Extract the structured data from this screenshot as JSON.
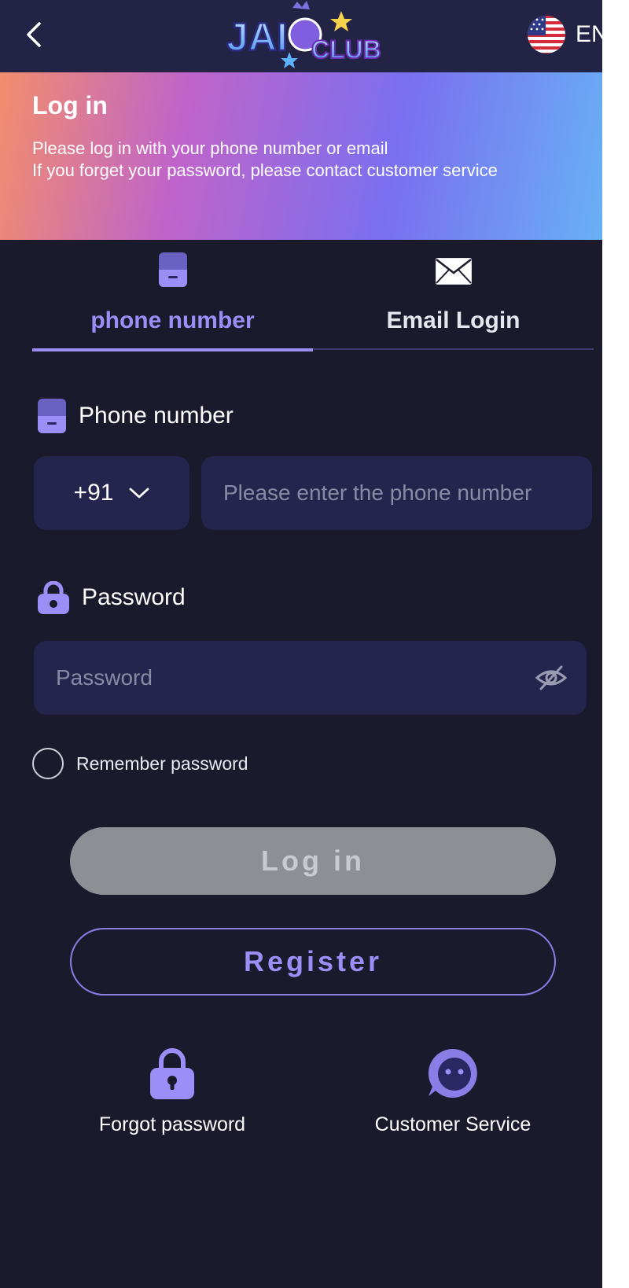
{
  "header": {
    "logo_text_main": "JAI",
    "logo_text_sub": "CLUB",
    "language_code": "EN"
  },
  "banner": {
    "title": "Log in",
    "line1": "Please log in with your phone number or email",
    "line2": "If you forget your password, please contact customer service"
  },
  "tabs": [
    {
      "label": "phone number",
      "active": true
    },
    {
      "label": "Email Login",
      "active": false
    }
  ],
  "phone_field": {
    "label": "Phone number",
    "country_code": "+91",
    "placeholder": "Please enter the phone number"
  },
  "password_field": {
    "label": "Password",
    "placeholder": "Password"
  },
  "remember_label": "Remember password",
  "buttons": {
    "login": "Log in",
    "register": "Register"
  },
  "bottom_links": {
    "forgot": "Forgot password",
    "service": "Customer Service"
  },
  "colors": {
    "background": "#1b1a2d",
    "header": "#232346",
    "accent": "#9b8ef6",
    "input_bg": "#24244d",
    "login_disabled": "#8e8f95"
  }
}
